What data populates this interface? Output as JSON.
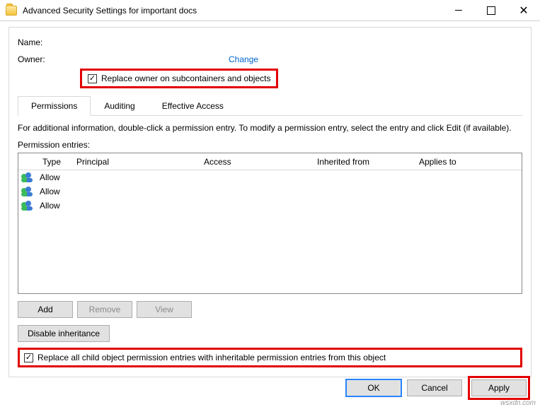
{
  "window": {
    "title": "Advanced Security Settings for important docs"
  },
  "labels": {
    "name": "Name:",
    "owner": "Owner:",
    "change": "Change",
    "replace_owner": "Replace owner on subcontainers and objects",
    "info": "For additional information, double-click a permission entry. To modify a permission entry, select the entry and click Edit (if available).",
    "perm_entries": "Permission entries:",
    "replace_child": "Replace all child object permission entries with inheritable permission entries from this object"
  },
  "tabs": [
    {
      "label": "Permissions",
      "active": true
    },
    {
      "label": "Auditing",
      "active": false
    },
    {
      "label": "Effective Access",
      "active": false
    }
  ],
  "columns": {
    "type": "Type",
    "principal": "Principal",
    "access": "Access",
    "inherited": "Inherited from",
    "applies": "Applies to"
  },
  "rows": [
    {
      "type": "Allow"
    },
    {
      "type": "Allow"
    },
    {
      "type": "Allow"
    }
  ],
  "buttons": {
    "add": "Add",
    "remove": "Remove",
    "view": "View",
    "disable_inherit": "Disable inheritance",
    "ok": "OK",
    "cancel": "Cancel",
    "apply": "Apply"
  },
  "watermark": "wsxdn.com"
}
